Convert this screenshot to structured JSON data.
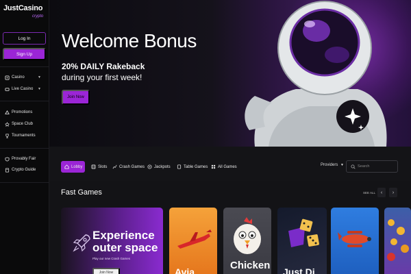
{
  "brand": {
    "name": "JustCasino",
    "sub": "crypto"
  },
  "auth": {
    "login": "Log In",
    "signup": "Sign Up"
  },
  "sidebar": {
    "group1": [
      {
        "label": "Casino",
        "icon": "casino-icon"
      },
      {
        "label": "Live Casino",
        "icon": "live-casino-icon"
      }
    ],
    "group2": [
      {
        "label": "Promotions",
        "icon": "promotions-icon"
      },
      {
        "label": "Space Club",
        "icon": "space-club-icon"
      },
      {
        "label": "Tournaments",
        "icon": "tournaments-icon"
      }
    ],
    "group3": [
      {
        "label": "Provably Fair",
        "icon": "shield-icon"
      },
      {
        "label": "Crypto Guide",
        "icon": "guide-icon"
      }
    ]
  },
  "hero": {
    "title": "Welcome Bonus",
    "subtitle": "20% DAILY Rakeback",
    "subtitle2": "during your first week!",
    "cta": "Join Now"
  },
  "tabs": [
    {
      "label": "Lobby",
      "active": true,
      "icon": "lobby-icon"
    },
    {
      "label": "Slots",
      "active": false,
      "icon": "slots-icon"
    },
    {
      "label": "Crash Games",
      "active": false,
      "icon": "crash-icon"
    },
    {
      "label": "Jackpots",
      "active": false,
      "icon": "jackpot-icon"
    },
    {
      "label": "Table Games",
      "active": false,
      "icon": "table-games-icon"
    },
    {
      "label": "All Games",
      "active": false,
      "icon": "all-games-icon"
    }
  ],
  "providers": "Providers",
  "search": {
    "placeholder": "Search"
  },
  "fast_games": {
    "title": "Fast Games",
    "see_all": "SEE ALL",
    "promo": {
      "title_line1": "Experience",
      "title_line2": "outer space",
      "sub": "Play our new Crash Games",
      "button": "Join Now"
    },
    "cards": [
      {
        "name": "Aviator",
        "visible_text": "Avia"
      },
      {
        "name": "Chicken",
        "visible_text": "Chicken"
      },
      {
        "name": "Just Dice",
        "visible_text": "Just Di"
      },
      {
        "name": "Plane game",
        "visible_text": ""
      },
      {
        "name": "Coins game",
        "visible_text": ""
      }
    ]
  },
  "colors": {
    "accent": "#9b25d6",
    "bg": "#0b0b0d",
    "panel": "#141417"
  }
}
